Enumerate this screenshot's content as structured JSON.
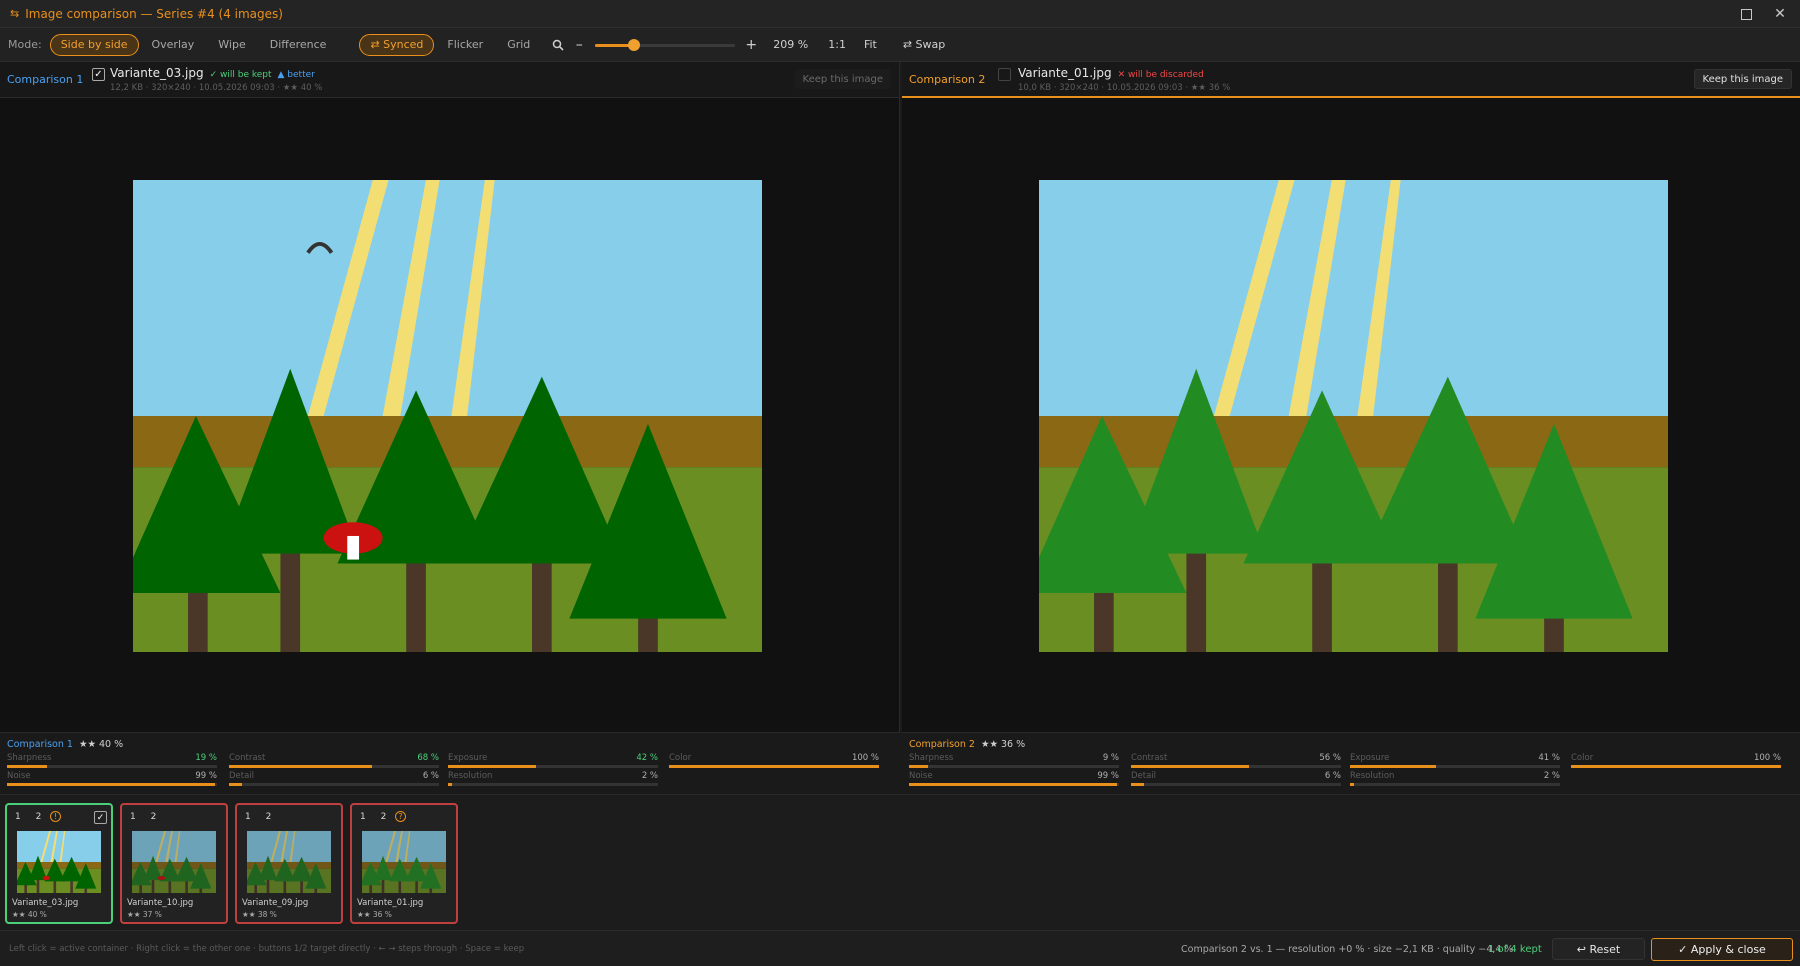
{
  "window": {
    "icon": "compare-icon",
    "title": "Image comparison — Series #4 (4 images)"
  },
  "toolbar": {
    "mode_label": "Mode:",
    "modes": [
      "Side by side",
      "Overlay",
      "Wipe",
      "Difference"
    ],
    "synced": "⇄ Synced",
    "views": [
      "Flicker",
      "Grid"
    ],
    "zoom_value": "209 %",
    "zoom_fraction": 0.28,
    "one_to_one": "1:1",
    "fit": "Fit",
    "swap": "⇄ Swap"
  },
  "left": {
    "tag": "Comparison 1",
    "filename": "Variante_03.jpg",
    "status": "✓ will be kept",
    "better": "▲ better",
    "meta": "12,2 KB · 320×240 · 10.05.2026 09:03 · ★★ 40 %",
    "keep": "Keep this image",
    "stats_title": "Comparison 1",
    "stats_stars": "★★ 40 %",
    "metrics": [
      {
        "name": "Sharpness",
        "value": "19 %",
        "f": 0.19
      },
      {
        "name": "Contrast",
        "value": "68 %",
        "f": 0.68
      },
      {
        "name": "Exposure",
        "value": "42 %",
        "f": 0.42
      },
      {
        "name": "Color",
        "value": "100 %",
        "f": 1.0
      },
      {
        "name": "Noise",
        "value": "99 %",
        "f": 0.99
      },
      {
        "name": "Detail",
        "value": "6 %",
        "f": 0.06
      },
      {
        "name": "Resolution",
        "value": "2 %",
        "f": 0.02
      }
    ]
  },
  "right": {
    "tag": "Comparison 2",
    "filename": "Variante_01.jpg",
    "status": "✕ will be discarded",
    "meta": "10,0 KB · 320×240 · 10.05.2026 09:03 · ★★ 36 %",
    "keep": "Keep this image",
    "stats_title": "Comparison 2",
    "stats_stars": "★★ 36 %",
    "metrics": [
      {
        "name": "Sharpness",
        "value": "9 %",
        "f": 0.09
      },
      {
        "name": "Contrast",
        "value": "56 %",
        "f": 0.56
      },
      {
        "name": "Exposure",
        "value": "41 %",
        "f": 0.41
      },
      {
        "name": "Color",
        "value": "100 %",
        "f": 1.0
      },
      {
        "name": "Noise",
        "value": "99 %",
        "f": 0.99
      },
      {
        "name": "Detail",
        "value": "6 %",
        "f": 0.06
      },
      {
        "name": "Resolution",
        "value": "2 %",
        "f": 0.02
      }
    ]
  },
  "thumbs": [
    {
      "nums": "1 2",
      "name": "Variante_03.jpg",
      "stars": "★★ 40 %"
    },
    {
      "nums": "1 2",
      "name": "Variante_10.jpg",
      "stars": "★★ 37 %"
    },
    {
      "nums": "1 2",
      "name": "Variante_09.jpg",
      "stars": "★★ 38 %"
    },
    {
      "nums": "1 2",
      "name": "Variante_01.jpg",
      "stars": "★★ 36 %"
    }
  ],
  "status": {
    "hint": "Left click = active container · Right click = the other one · buttons 1/2 target directly · ← → steps through · Space = keep",
    "comparison": "Comparison 2 vs. 1 — resolution +0 % · size −2,1 KB · quality −4,4 %",
    "kept": "1 of 4 kept",
    "reset": "↩ Reset",
    "apply": "✓ Apply & close"
  },
  "colors": {
    "accent": "#e8901b",
    "kept": "#4bd07a",
    "discard": "#f04848",
    "info": "#4aa0f0"
  }
}
